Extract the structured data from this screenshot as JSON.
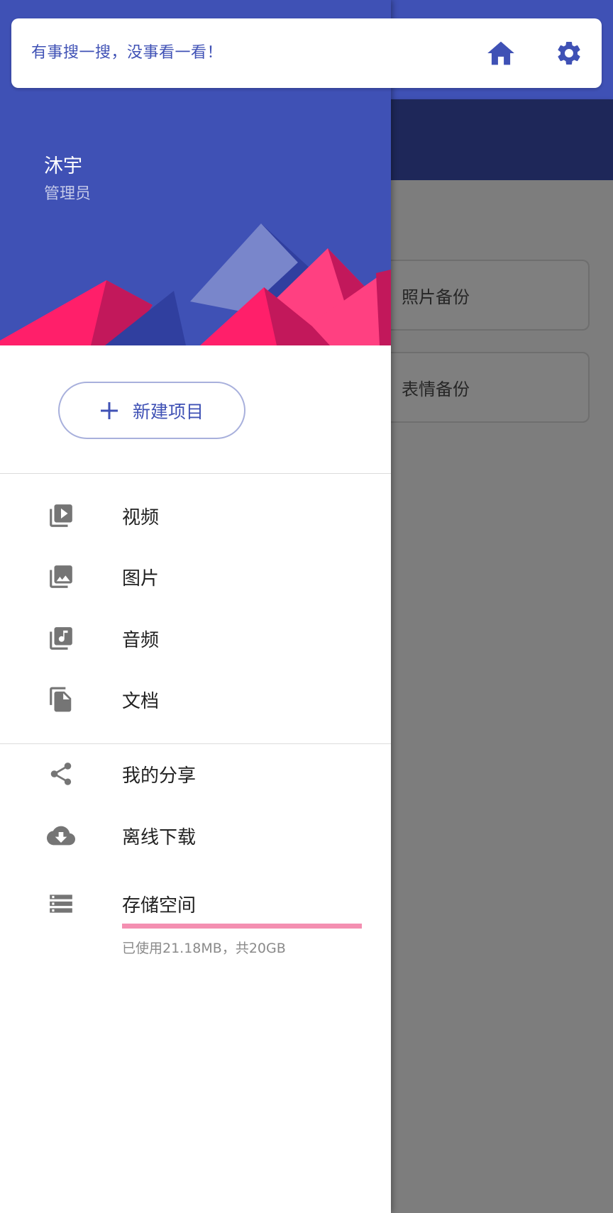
{
  "search": {
    "hint": "有事搜一搜，没事看一看！"
  },
  "header_icons": {
    "home": "home-icon",
    "settings": "gear-icon"
  },
  "background": {
    "cards": [
      {
        "label": "照片备份"
      },
      {
        "label": "表情备份"
      }
    ]
  },
  "drawer": {
    "user": {
      "name": "沐宇",
      "role": "管理员"
    },
    "new_button": {
      "label": "新建项目",
      "icon": "plus-icon"
    },
    "media_items": [
      {
        "label": "视频",
        "icon": "video-library-icon"
      },
      {
        "label": "图片",
        "icon": "photo-library-icon"
      },
      {
        "label": "音频",
        "icon": "music-library-icon"
      },
      {
        "label": "文档",
        "icon": "documents-icon"
      }
    ],
    "other_items": [
      {
        "label": "我的分享",
        "icon": "share-icon"
      },
      {
        "label": "离线下载",
        "icon": "cloud-download-icon"
      }
    ],
    "storage": {
      "label": "存储空间",
      "icon": "storage-icon",
      "usage_text": "已使用21.18MB，共20GB",
      "used_fraction": 0.001
    }
  },
  "colors": {
    "primary": "#3f51b5",
    "dark_primary": "#1e2759",
    "accent": "#f48fb1",
    "mountain_pink": "#ff1f6a",
    "icon_gray": "#757575"
  }
}
